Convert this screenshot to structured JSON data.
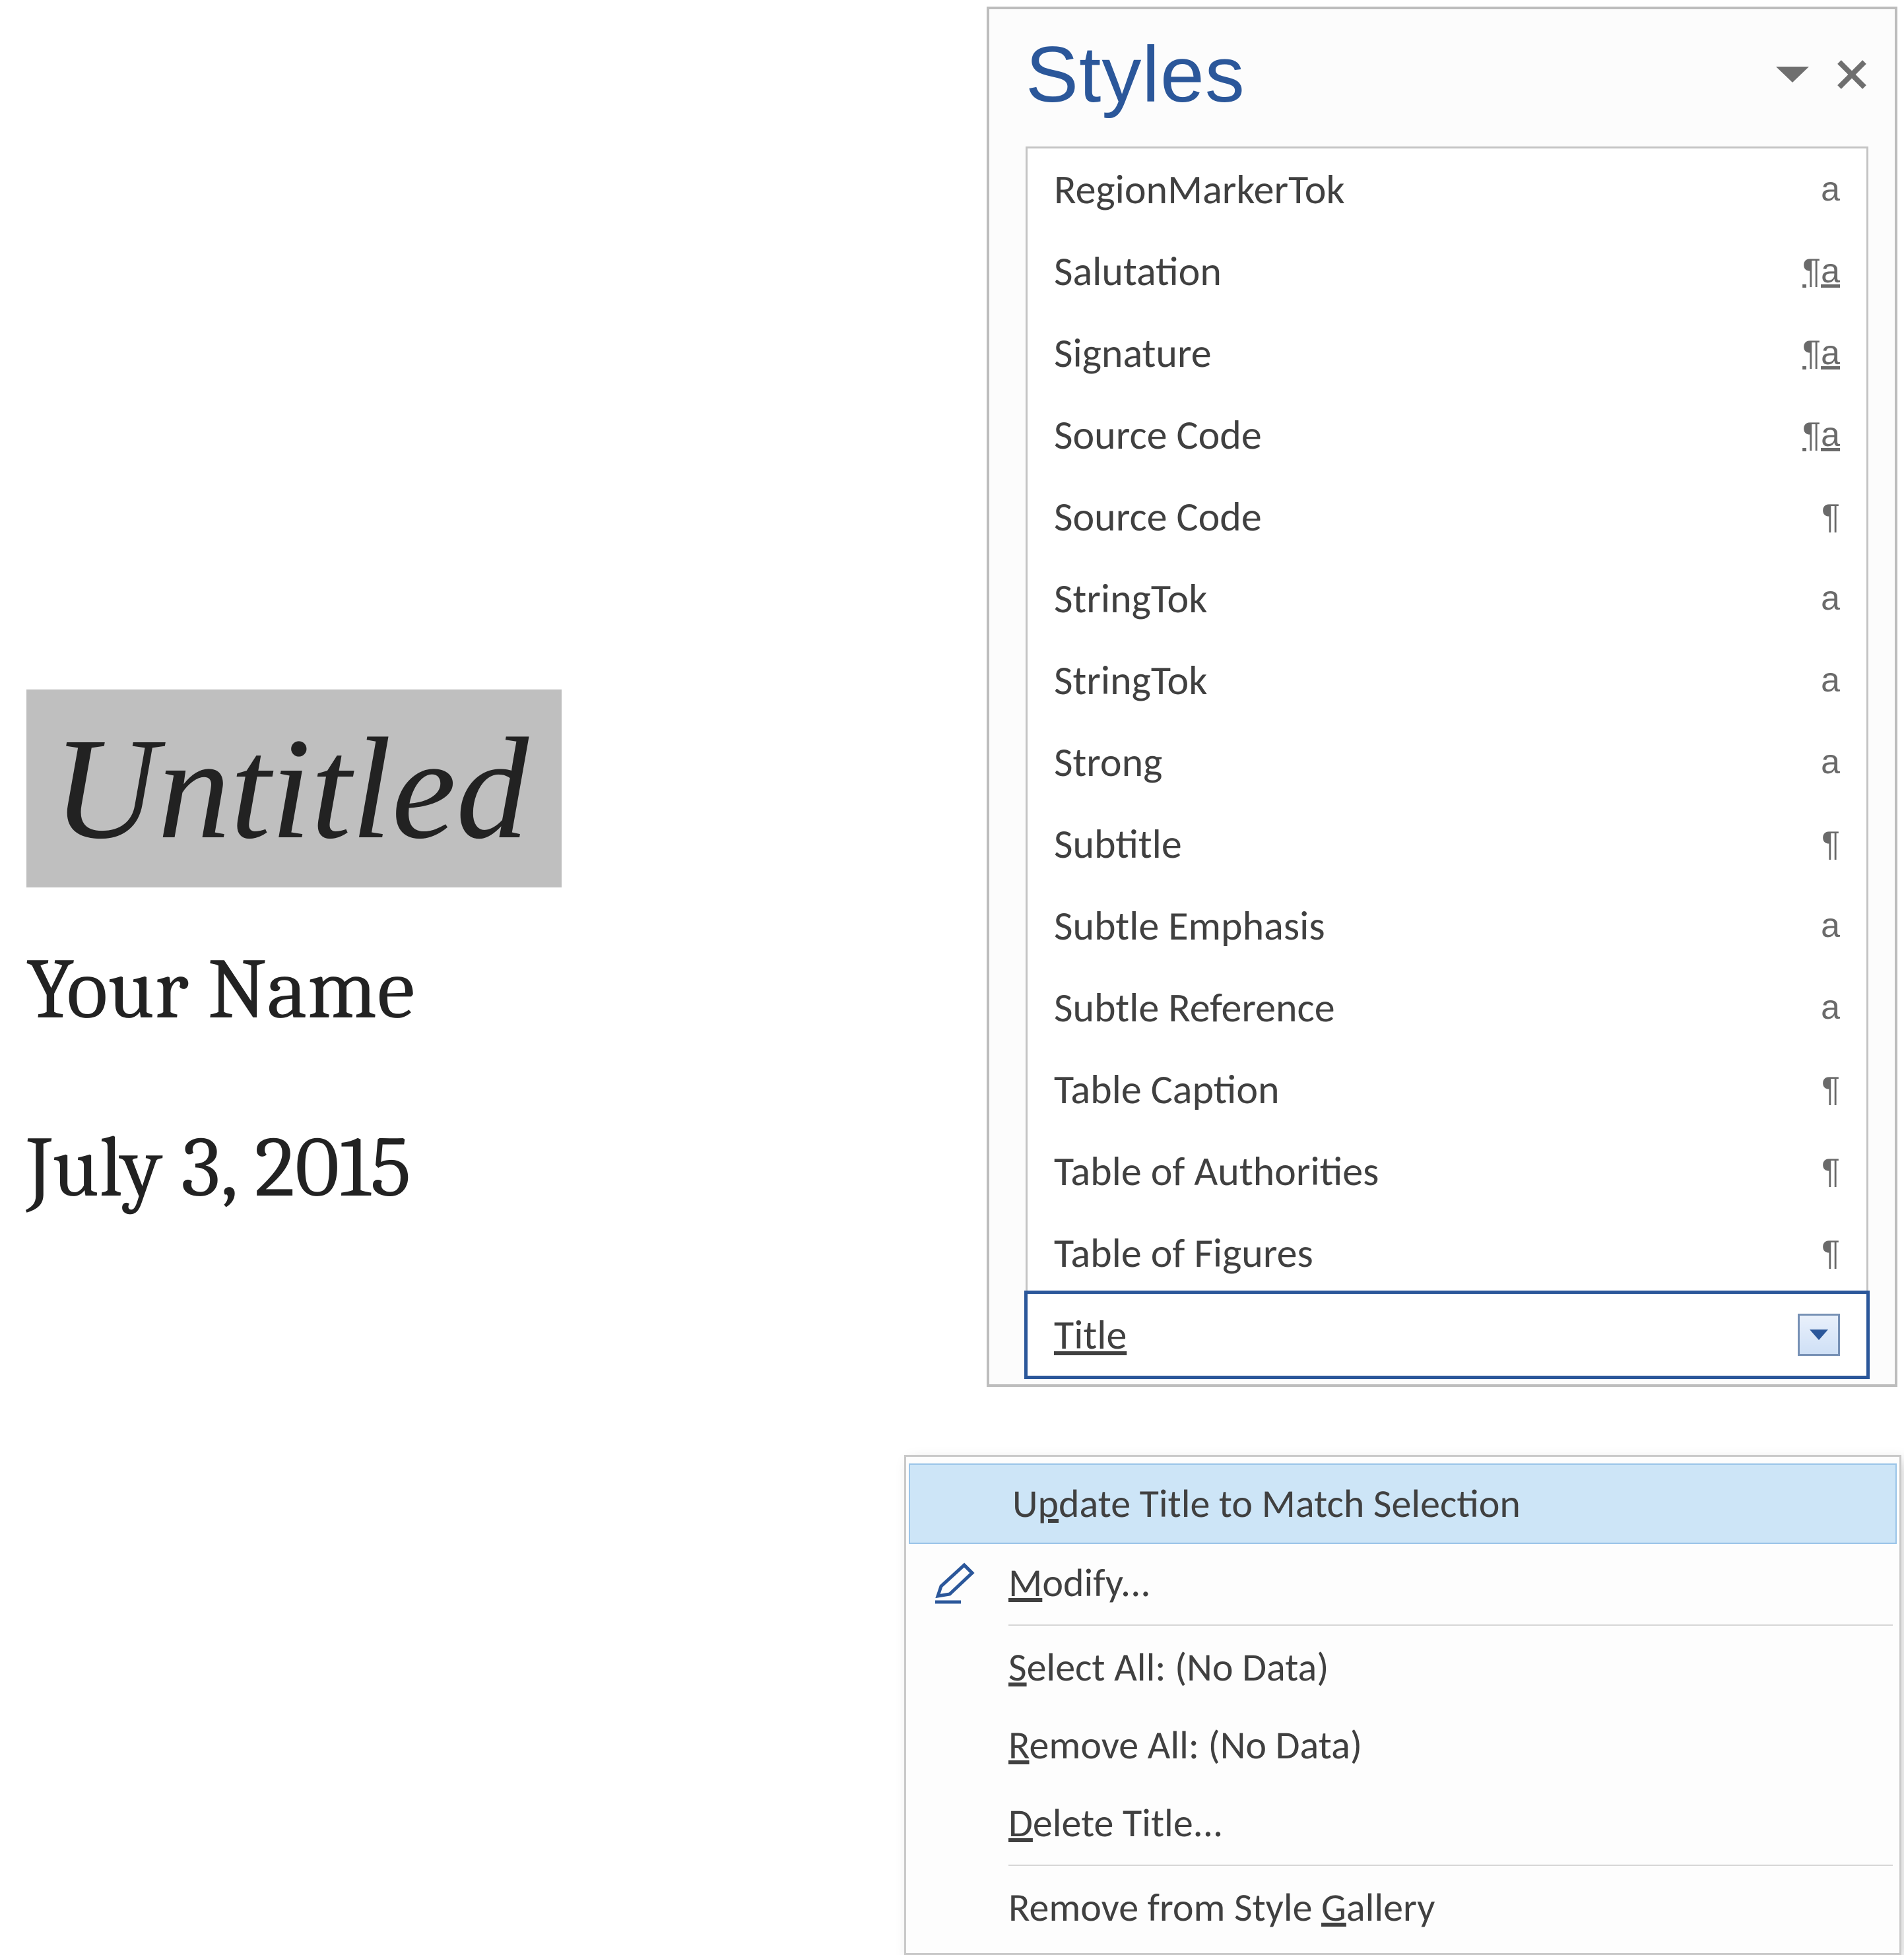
{
  "document": {
    "title_text": "Untitled",
    "author_text": "Your Name",
    "date_text": "July 3, 2015"
  },
  "styles_pane": {
    "header_title": "Styles",
    "items": [
      {
        "label": "RegionMarkerTok",
        "type_glyph": "a",
        "type_class": "char"
      },
      {
        "label": "Salutation",
        "type_glyph": "¶a",
        "type_class": "linked"
      },
      {
        "label": "Signature",
        "type_glyph": "¶a",
        "type_class": "linked"
      },
      {
        "label": "Source Code",
        "type_glyph": "¶a",
        "type_class": "linked"
      },
      {
        "label": "Source Code",
        "type_glyph": "¶",
        "type_class": "para"
      },
      {
        "label": "StringTok",
        "type_glyph": "a",
        "type_class": "char"
      },
      {
        "label": "StringTok",
        "type_glyph": "a",
        "type_class": "char"
      },
      {
        "label": "Strong",
        "type_glyph": "a",
        "type_class": "char"
      },
      {
        "label": "Subtitle",
        "type_glyph": "¶",
        "type_class": "para"
      },
      {
        "label": "Subtle Emphasis",
        "type_glyph": "a",
        "type_class": "char"
      },
      {
        "label": "Subtle Reference",
        "type_glyph": "a",
        "type_class": "char"
      },
      {
        "label": "Table Caption",
        "type_glyph": "¶",
        "type_class": "para"
      },
      {
        "label": "Table of Authorities",
        "type_glyph": "¶",
        "type_class": "para"
      },
      {
        "label": "Table of Figures",
        "type_glyph": "¶",
        "type_class": "para"
      }
    ],
    "selected_label": "Title"
  },
  "context_menu": {
    "update_label": "Update Title to Match Selection",
    "modify_label": "Modify...",
    "select_all_label": "Select All: (No Data)",
    "remove_all_label": "Remove All: (No Data)",
    "delete_label": "Delete Title...",
    "remove_gallery_label": "Remove from Style Gallery"
  }
}
